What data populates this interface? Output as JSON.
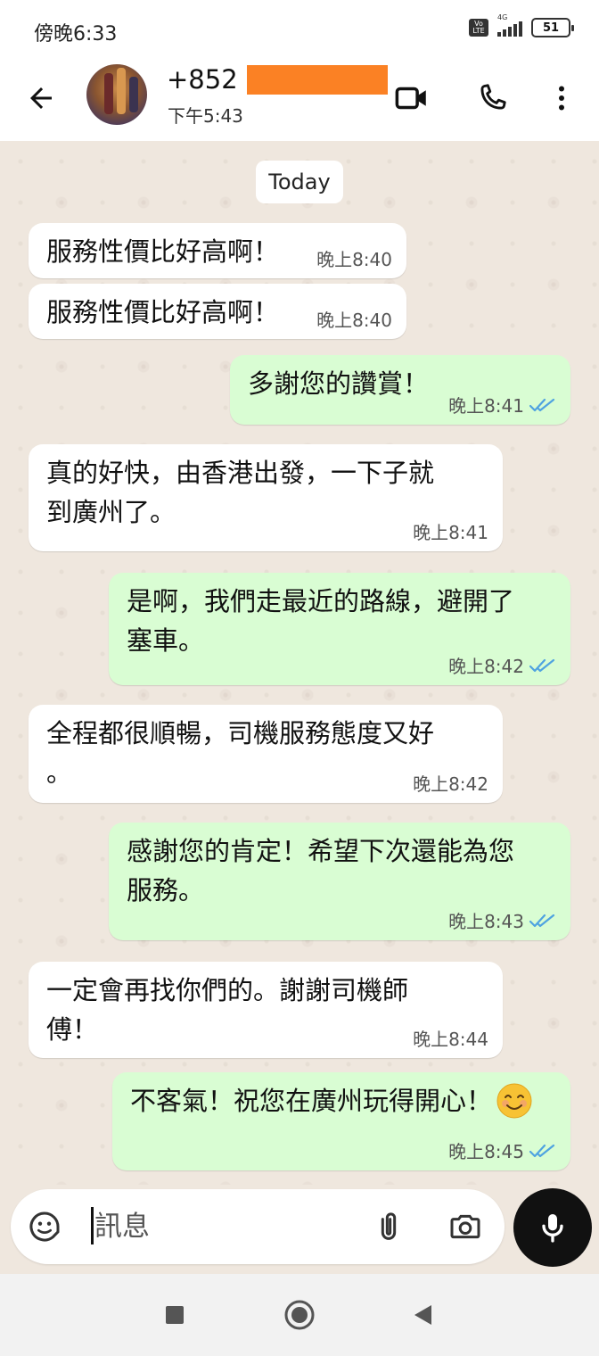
{
  "status_bar": {
    "time": "傍晚6:33",
    "volte_label": "Vo LTE",
    "network_label": "4G",
    "battery": "51"
  },
  "header": {
    "contact_name": "+852",
    "contact_status": "下午5:43",
    "redaction_color": "#fb8124"
  },
  "chat": {
    "date_divider": "Today",
    "messages": [
      {
        "direction": "in",
        "text": "服務性價比好高啊！",
        "time": "晚上8:40"
      },
      {
        "direction": "in",
        "text": "服務性價比好高啊！",
        "time": "晚上8:40"
      },
      {
        "direction": "out",
        "text": "多謝您的讚賞！",
        "time": "晚上8:41",
        "read": true
      },
      {
        "direction": "in",
        "text": "真的好快，由香港出發，一下子就\n到廣州了。",
        "time": "晚上8:41"
      },
      {
        "direction": "out",
        "text": "是啊，我們走最近的路線，避開了\n塞車。",
        "time": "晚上8:42",
        "read": true
      },
      {
        "direction": "in",
        "text": "全程都很順暢，司機服務態度又好\n。",
        "time": "晚上8:42"
      },
      {
        "direction": "out",
        "text": "感謝您的肯定！希望下次還能為您\n服務。",
        "time": "晚上8:43",
        "read": true
      },
      {
        "direction": "in",
        "text": "一定會再找你們的。謝謝司機師\n傅！",
        "time": "晚上8:44"
      },
      {
        "direction": "out",
        "text": "不客氣！祝您在廣州玩得開心！",
        "emoji": "smiling-face",
        "time": "晚上8:45",
        "read": true
      }
    ]
  },
  "composer": {
    "placeholder": "訊息"
  },
  "colors": {
    "chat_background": "#efe7de",
    "incoming_bubble": "#ffffff",
    "outgoing_bubble": "#d9fdd3",
    "read_ticks": "#4fa3e0",
    "mic_button": "#111111"
  },
  "icons": {
    "back": "arrow-left-icon",
    "video_call": "video-camera-icon",
    "voice_call": "phone-icon",
    "menu": "more-vert-icon",
    "sticker": "sticker-icon",
    "attach": "paperclip-icon",
    "camera": "camera-icon",
    "mic": "microphone-icon",
    "read_receipt": "double-check-icon",
    "nav_recents": "square-icon",
    "nav_home": "circle-icon",
    "nav_back": "triangle-back-icon"
  }
}
